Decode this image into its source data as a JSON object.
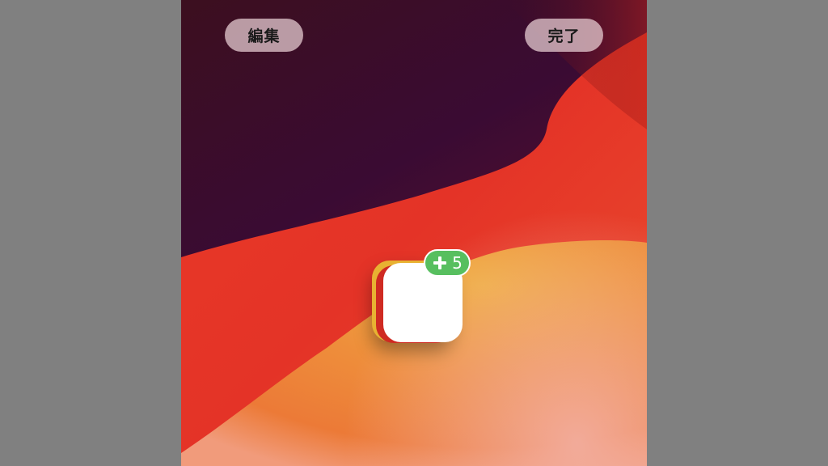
{
  "toolbar": {
    "edit_label": "編集",
    "done_label": "完了"
  },
  "drag_stack": {
    "badge_count": "5",
    "badge_icon": "plus-icon"
  },
  "colors": {
    "background_gray": "#808080",
    "badge_green": "#57bf5f",
    "app_white": "#ffffff",
    "app_red": "#cf2a22",
    "app_yellow": "#e8b232"
  }
}
